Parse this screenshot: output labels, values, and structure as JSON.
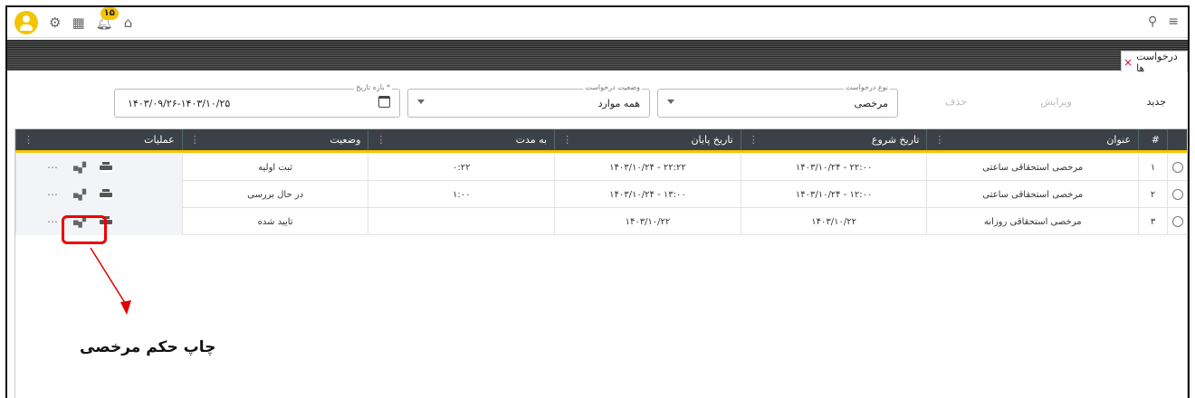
{
  "topbar": {
    "notification_count": "۱۵"
  },
  "tab": {
    "label": "درخواست ها",
    "close": "×"
  },
  "actions": {
    "new": "جدید",
    "edit": "ویرایش",
    "delete": "حذف"
  },
  "filters": {
    "request_type": {
      "label": "نوع درخواست",
      "value": "مرخصی"
    },
    "request_status": {
      "label": "وضعیت درخواست",
      "value": "همه موارد"
    },
    "date_range": {
      "label": "بازه تاریخ *",
      "value": "۱۴۰۳/۰۹/۲۶-۱۴۰۳/۱۰/۲۵"
    }
  },
  "table": {
    "columns": {
      "num": "#",
      "title": "عنوان",
      "start": "تاریخ شروع",
      "end": "تاریخ پایان",
      "duration": "به مدت",
      "status": "وضعیت",
      "ops": "عملیات"
    },
    "rows": [
      {
        "num": "۱",
        "title": "مرخصی استحقاقی ساعتی",
        "start": "۱۴۰۳/۱۰/۲۴ - ۲۲:۰۰",
        "end": "۱۴۰۳/۱۰/۲۴ - ۲۲:۲۲",
        "duration": "۰:۲۲",
        "status": "ثبت اولیه"
      },
      {
        "num": "۲",
        "title": "مرخصی استحقاقی ساعتی",
        "start": "۱۴۰۳/۱۰/۲۴ - ۱۲:۰۰",
        "end": "۱۴۰۳/۱۰/۲۴ - ۱۳:۰۰",
        "duration": "۱:۰۰",
        "status": "در حال بررسی"
      },
      {
        "num": "۳",
        "title": "مرخصی استحقاقی روزانه",
        "start": "۱۴۰۳/۱۰/۲۲",
        "end": "۱۴۰۳/۱۰/۲۲",
        "duration": "",
        "status": "تایید شده"
      }
    ]
  },
  "annotation": {
    "caption": "چاپ حکم مرخصی",
    "color": "#e00000"
  },
  "colors": {
    "accent": "#f5c400",
    "header_bg": "#3b4147"
  }
}
